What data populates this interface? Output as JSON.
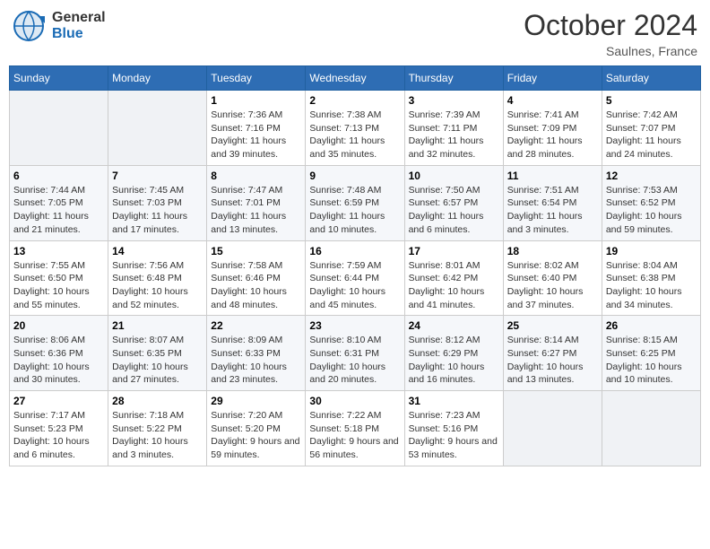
{
  "header": {
    "logo_name": "General",
    "logo_sub": "Blue",
    "month_title": "October 2024",
    "location": "Saulnes, France"
  },
  "calendar": {
    "days_of_week": [
      "Sunday",
      "Monday",
      "Tuesday",
      "Wednesday",
      "Thursday",
      "Friday",
      "Saturday"
    ],
    "weeks": [
      [
        {
          "day": "",
          "info": ""
        },
        {
          "day": "",
          "info": ""
        },
        {
          "day": "1",
          "info": "Sunrise: 7:36 AM\nSunset: 7:16 PM\nDaylight: 11 hours and 39 minutes."
        },
        {
          "day": "2",
          "info": "Sunrise: 7:38 AM\nSunset: 7:13 PM\nDaylight: 11 hours and 35 minutes."
        },
        {
          "day": "3",
          "info": "Sunrise: 7:39 AM\nSunset: 7:11 PM\nDaylight: 11 hours and 32 minutes."
        },
        {
          "day": "4",
          "info": "Sunrise: 7:41 AM\nSunset: 7:09 PM\nDaylight: 11 hours and 28 minutes."
        },
        {
          "day": "5",
          "info": "Sunrise: 7:42 AM\nSunset: 7:07 PM\nDaylight: 11 hours and 24 minutes."
        }
      ],
      [
        {
          "day": "6",
          "info": "Sunrise: 7:44 AM\nSunset: 7:05 PM\nDaylight: 11 hours and 21 minutes."
        },
        {
          "day": "7",
          "info": "Sunrise: 7:45 AM\nSunset: 7:03 PM\nDaylight: 11 hours and 17 minutes."
        },
        {
          "day": "8",
          "info": "Sunrise: 7:47 AM\nSunset: 7:01 PM\nDaylight: 11 hours and 13 minutes."
        },
        {
          "day": "9",
          "info": "Sunrise: 7:48 AM\nSunset: 6:59 PM\nDaylight: 11 hours and 10 minutes."
        },
        {
          "day": "10",
          "info": "Sunrise: 7:50 AM\nSunset: 6:57 PM\nDaylight: 11 hours and 6 minutes."
        },
        {
          "day": "11",
          "info": "Sunrise: 7:51 AM\nSunset: 6:54 PM\nDaylight: 11 hours and 3 minutes."
        },
        {
          "day": "12",
          "info": "Sunrise: 7:53 AM\nSunset: 6:52 PM\nDaylight: 10 hours and 59 minutes."
        }
      ],
      [
        {
          "day": "13",
          "info": "Sunrise: 7:55 AM\nSunset: 6:50 PM\nDaylight: 10 hours and 55 minutes."
        },
        {
          "day": "14",
          "info": "Sunrise: 7:56 AM\nSunset: 6:48 PM\nDaylight: 10 hours and 52 minutes."
        },
        {
          "day": "15",
          "info": "Sunrise: 7:58 AM\nSunset: 6:46 PM\nDaylight: 10 hours and 48 minutes."
        },
        {
          "day": "16",
          "info": "Sunrise: 7:59 AM\nSunset: 6:44 PM\nDaylight: 10 hours and 45 minutes."
        },
        {
          "day": "17",
          "info": "Sunrise: 8:01 AM\nSunset: 6:42 PM\nDaylight: 10 hours and 41 minutes."
        },
        {
          "day": "18",
          "info": "Sunrise: 8:02 AM\nSunset: 6:40 PM\nDaylight: 10 hours and 37 minutes."
        },
        {
          "day": "19",
          "info": "Sunrise: 8:04 AM\nSunset: 6:38 PM\nDaylight: 10 hours and 34 minutes."
        }
      ],
      [
        {
          "day": "20",
          "info": "Sunrise: 8:06 AM\nSunset: 6:36 PM\nDaylight: 10 hours and 30 minutes."
        },
        {
          "day": "21",
          "info": "Sunrise: 8:07 AM\nSunset: 6:35 PM\nDaylight: 10 hours and 27 minutes."
        },
        {
          "day": "22",
          "info": "Sunrise: 8:09 AM\nSunset: 6:33 PM\nDaylight: 10 hours and 23 minutes."
        },
        {
          "day": "23",
          "info": "Sunrise: 8:10 AM\nSunset: 6:31 PM\nDaylight: 10 hours and 20 minutes."
        },
        {
          "day": "24",
          "info": "Sunrise: 8:12 AM\nSunset: 6:29 PM\nDaylight: 10 hours and 16 minutes."
        },
        {
          "day": "25",
          "info": "Sunrise: 8:14 AM\nSunset: 6:27 PM\nDaylight: 10 hours and 13 minutes."
        },
        {
          "day": "26",
          "info": "Sunrise: 8:15 AM\nSunset: 6:25 PM\nDaylight: 10 hours and 10 minutes."
        }
      ],
      [
        {
          "day": "27",
          "info": "Sunrise: 7:17 AM\nSunset: 5:23 PM\nDaylight: 10 hours and 6 minutes."
        },
        {
          "day": "28",
          "info": "Sunrise: 7:18 AM\nSunset: 5:22 PM\nDaylight: 10 hours and 3 minutes."
        },
        {
          "day": "29",
          "info": "Sunrise: 7:20 AM\nSunset: 5:20 PM\nDaylight: 9 hours and 59 minutes."
        },
        {
          "day": "30",
          "info": "Sunrise: 7:22 AM\nSunset: 5:18 PM\nDaylight: 9 hours and 56 minutes."
        },
        {
          "day": "31",
          "info": "Sunrise: 7:23 AM\nSunset: 5:16 PM\nDaylight: 9 hours and 53 minutes."
        },
        {
          "day": "",
          "info": ""
        },
        {
          "day": "",
          "info": ""
        }
      ]
    ]
  }
}
